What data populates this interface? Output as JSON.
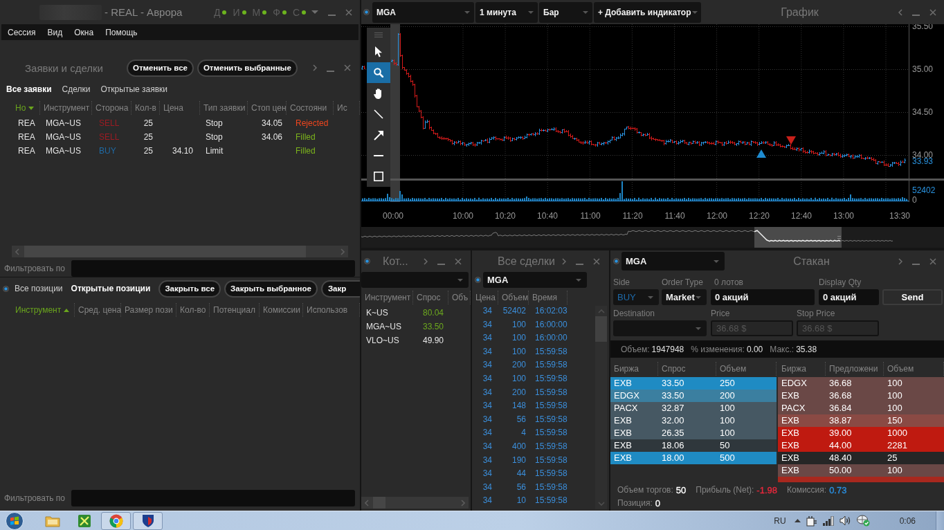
{
  "window": {
    "title": "- REAL - Аврора",
    "connections": [
      {
        "label": "Д",
        "connected": true
      },
      {
        "label": "И",
        "connected": true
      },
      {
        "label": "М",
        "connected": true
      },
      {
        "label": "Ф",
        "connected": true
      },
      {
        "label": "С",
        "connected": true
      }
    ]
  },
  "menu": [
    "Сессия",
    "Вид",
    "Окна",
    "Помощь"
  ],
  "orders_panel": {
    "title": "Заявки и сделки",
    "buttons": [
      "Отменить все",
      "Отменить выбранные"
    ],
    "tabs": [
      {
        "label": "Все заявки",
        "selected": true
      },
      {
        "label": "Сделки",
        "selected": false
      },
      {
        "label": "Открытые заявки",
        "selected": false
      }
    ],
    "columns": [
      {
        "label": "Но",
        "sorted": true,
        "ascending": false
      },
      {
        "label": "Инструмент",
        "sorted": false
      },
      {
        "label": "Сторона",
        "sorted": false
      },
      {
        "label": "Кол-в",
        "sorted": false
      },
      {
        "label": "Цена",
        "sorted": false
      },
      {
        "label": "Тип заявки",
        "sorted": false
      },
      {
        "label": "Стоп цен",
        "sorted": false
      },
      {
        "label": "Состояни",
        "sorted": false
      },
      {
        "label": "Ис",
        "sorted": false
      }
    ],
    "rows": [
      {
        "account": "REA",
        "instrument": "MGA~US",
        "side": {
          "label": "SELL",
          "color": "#9c1b22"
        },
        "quantity": "25",
        "type": "Stop",
        "stop_price": "34.05",
        "status": {
          "label": "Rejected",
          "color": "#f0461e"
        }
      },
      {
        "account": "REA",
        "instrument": "MGA~US",
        "side": {
          "label": "SELL",
          "color": "#9c1b22"
        },
        "quantity": "25",
        "type": "Stop",
        "stop_price": "34.06",
        "status": {
          "label": "Filled",
          "color": "#7cb41c"
        }
      },
      {
        "account": "REA",
        "instrument": "MGA~US",
        "side": {
          "label": "BUY",
          "color": "#1f6aa5"
        },
        "quantity": "25",
        "price": "34.10",
        "type": "Limit",
        "status": {
          "label": "Filled",
          "color": "#7cb41c"
        }
      }
    ],
    "filter_label": "Фильтровать по"
  },
  "positions_panel": {
    "linked": true,
    "tabs": [
      {
        "label": "Все позиции",
        "selected": false
      },
      {
        "label": "Открытые позиции",
        "selected": true
      }
    ],
    "buttons": [
      "Закрыть все",
      "Закрыть выбранное",
      "Закр"
    ],
    "columns": [
      {
        "label": "Инструмент",
        "sorted": true,
        "ascending": true
      },
      {
        "label": "Сред. цена",
        "sorted": false
      },
      {
        "label": "Размер пози",
        "sorted": false
      },
      {
        "label": "Кол-во",
        "sorted": false
      },
      {
        "label": "Потенциал",
        "sorted": false
      },
      {
        "label": "Комиссии",
        "sorted": false
      },
      {
        "label": "Использов",
        "sorted": false
      }
    ],
    "filter_label": "Фильтровать по"
  },
  "chart": {
    "linked": true,
    "symbol": "MGA",
    "interval": "1 минута",
    "style": "Бар",
    "add_indicator": "+ Добавить индикатор",
    "title": "График",
    "tools": [
      {
        "kind": "pointer",
        "selected": false
      },
      {
        "kind": "zoom",
        "selected": true
      },
      {
        "kind": "pan",
        "selected": false
      },
      {
        "kind": "line",
        "selected": false
      },
      {
        "kind": "arrow",
        "selected": false
      },
      {
        "kind": "hline",
        "selected": false
      },
      {
        "kind": "rect",
        "selected": false
      }
    ],
    "price_ticks": [
      "35.50",
      "35.00",
      "34.50",
      "34.00"
    ],
    "last_price": "33.93",
    "volume_ticks": [
      "52402",
      "0"
    ],
    "time_labels": [
      "00:00",
      "10:00",
      "10:20",
      "10:40",
      "11:00",
      "11:20",
      "11:40",
      "12:00",
      "12:20",
      "12:40",
      "13:00",
      "13:30"
    ],
    "markers": [
      {
        "kind": "buy"
      },
      {
        "kind": "sell"
      }
    ]
  },
  "quotes_panel": {
    "title": "Кот...",
    "linked": true,
    "columns": [
      "Инструмент",
      "Спрос",
      "Объ"
    ],
    "rows": [
      {
        "instrument": "K~US",
        "bid": "80.04",
        "color": "#6ca81e"
      },
      {
        "instrument": "MGA~US",
        "bid": "33.50",
        "color": "#6ca81e"
      },
      {
        "instrument": "VLO~US",
        "bid": "49.90",
        "color": "#e6e6e6"
      }
    ]
  },
  "trades_panel": {
    "title": "Все сделки",
    "linked": true,
    "symbol": "MGA",
    "columns": [
      "Цена",
      "Объем",
      "Время"
    ],
    "rows": [
      {
        "price": "34",
        "volume": "52402",
        "time": "16:02:03"
      },
      {
        "price": "34",
        "volume": "100",
        "time": "16:00:00"
      },
      {
        "price": "34",
        "volume": "100",
        "time": "16:00:00"
      },
      {
        "price": "34",
        "volume": "100",
        "time": "15:59:58"
      },
      {
        "price": "34",
        "volume": "200",
        "time": "15:59:58"
      },
      {
        "price": "34",
        "volume": "100",
        "time": "15:59:58"
      },
      {
        "price": "34",
        "volume": "200",
        "time": "15:59:58"
      },
      {
        "price": "34",
        "volume": "148",
        "time": "15:59:58"
      },
      {
        "price": "34",
        "volume": "56",
        "time": "15:59:58"
      },
      {
        "price": "34",
        "volume": "4",
        "time": "15:59:58"
      },
      {
        "price": "34",
        "volume": "400",
        "time": "15:59:58"
      },
      {
        "price": "34",
        "volume": "190",
        "time": "15:59:58"
      },
      {
        "price": "34",
        "volume": "44",
        "time": "15:59:58"
      },
      {
        "price": "34",
        "volume": "56",
        "time": "15:59:58"
      },
      {
        "price": "34",
        "volume": "10",
        "time": "15:59:58"
      }
    ]
  },
  "book_panel": {
    "linked": true,
    "symbol": "MGA",
    "title": "Стакан",
    "form": {
      "side": {
        "label": "Side",
        "value": "BUY"
      },
      "order_type": {
        "label": "Order Type",
        "value": "Market"
      },
      "quantity": {
        "label": "0 лотов",
        "value": "0 акций"
      },
      "display_qty": {
        "label": "Display Qty",
        "value": "0 акций"
      },
      "send": "Send",
      "destination": {
        "label": "Destination"
      },
      "price": {
        "label": "Price",
        "value": "36.68 $",
        "disabled": true
      },
      "stop_price": {
        "label": "Stop Price",
        "value": "36.68 $",
        "disabled": true
      }
    },
    "stats": [
      {
        "label": "Объем:",
        "value": "1947948"
      },
      {
        "label": "% изменения:",
        "value": "0.00"
      },
      {
        "label": "Макс.:",
        "value": "35.38"
      }
    ],
    "bid_columns": [
      "Биржа",
      "Спрос",
      "Объем"
    ],
    "ask_columns": [
      "Биржа",
      "Предложени",
      "Объем"
    ],
    "bids": [
      {
        "exchange": "EXB",
        "price": "33.50",
        "size": "250",
        "color": "#1f8bc3"
      },
      {
        "exchange": "EDGX",
        "price": "33.50",
        "size": "200",
        "color": "#3b7fa0"
      },
      {
        "exchange": "PACX",
        "price": "32.87",
        "size": "100",
        "color": "#465863"
      },
      {
        "exchange": "EXB",
        "price": "32.00",
        "size": "100",
        "color": "#465863"
      },
      {
        "exchange": "EXB",
        "price": "26.35",
        "size": "100",
        "color": "#465863"
      },
      {
        "exchange": "EXB",
        "price": "18.06",
        "size": "50",
        "color": "#2f373c"
      },
      {
        "exchange": "EXB",
        "price": "18.00",
        "size": "500",
        "color": "#1f8bc3"
      }
    ],
    "asks": [
      {
        "exchange": "EDGX",
        "price": "36.68",
        "size": "100",
        "color": "#6a4846"
      },
      {
        "exchange": "EXB",
        "price": "36.68",
        "size": "100",
        "color": "#6a4846"
      },
      {
        "exchange": "PACX",
        "price": "36.84",
        "size": "100",
        "color": "#6a4846"
      },
      {
        "exchange": "EXB",
        "price": "38.87",
        "size": "150",
        "color": "#8a4a44"
      },
      {
        "exchange": "EXB",
        "price": "39.00",
        "size": "1000",
        "color": "#bf1a10"
      },
      {
        "exchange": "EXB",
        "price": "44.00",
        "size": "2281",
        "color": "#bf1a10"
      },
      {
        "exchange": "EXB",
        "price": "48.40",
        "size": "25",
        "color": "#262626"
      },
      {
        "exchange": "EXB",
        "price": "50.00",
        "size": "100",
        "color": "#6a4846"
      },
      {
        "color": "#a8281e"
      }
    ],
    "summary": [
      {
        "label": "Объем торгов:",
        "value": "50",
        "color": "#ffffff"
      },
      {
        "label": "Прибыль (Net):",
        "value": "-1.98",
        "color": "#e8283c"
      },
      {
        "label": "Комиссия:",
        "value": "0.73",
        "color": "#2a8fe0"
      },
      {
        "label": "Позиция:",
        "value": "0",
        "color": "#ffffff"
      }
    ]
  },
  "taskbar": {
    "apps": [
      {
        "kind": "folder",
        "running": false
      },
      {
        "kind": "green_app",
        "running": false
      },
      {
        "kind": "browser",
        "running": true
      },
      {
        "kind": "shield_app",
        "running": true
      }
    ],
    "language": "RU",
    "clock": "0:06"
  }
}
